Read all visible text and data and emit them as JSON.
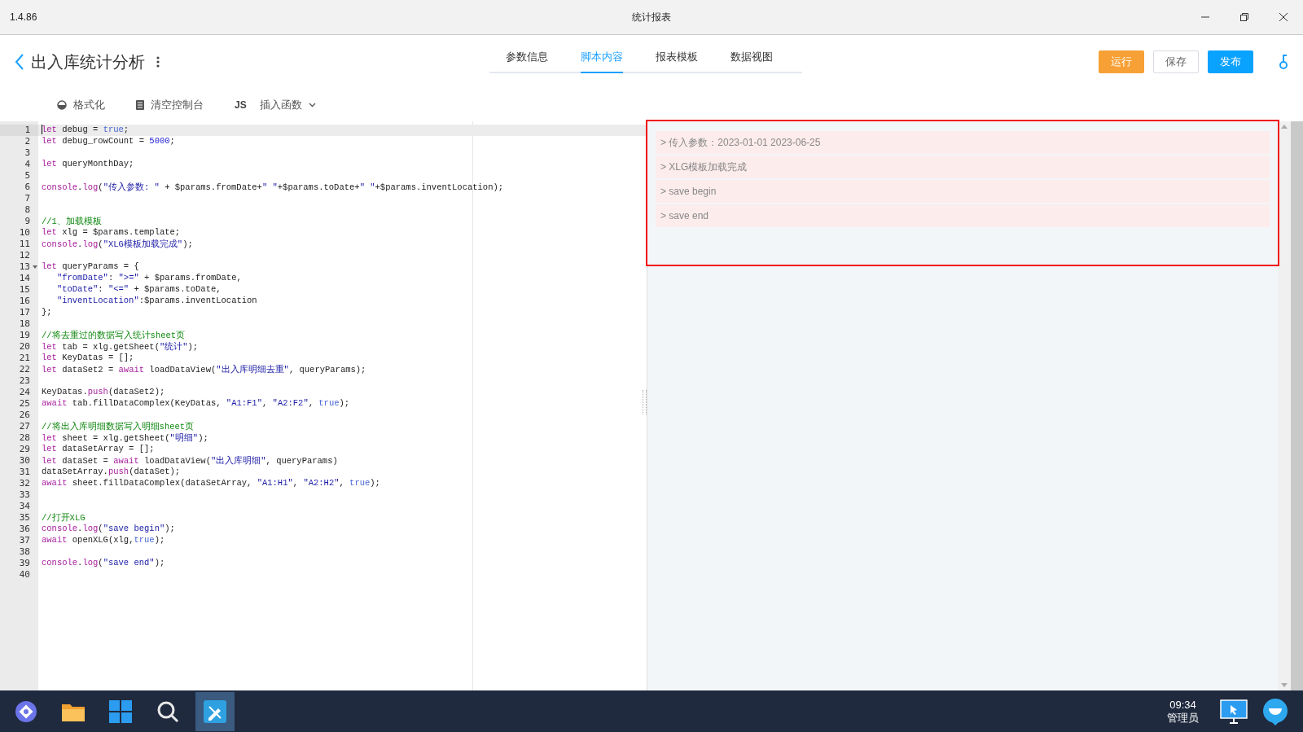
{
  "window": {
    "version": "1.4.86",
    "title": "统计报表"
  },
  "header": {
    "title": "出入库统计分析",
    "tabs": [
      {
        "label": "参数信息",
        "selected": false
      },
      {
        "label": "脚本内容",
        "selected": true
      },
      {
        "label": "报表模板",
        "selected": false
      },
      {
        "label": "数据视图",
        "selected": false
      }
    ],
    "buttons": [
      {
        "label": "运行",
        "kind": "warning"
      },
      {
        "label": "保存",
        "kind": "outline"
      },
      {
        "label": "发布",
        "kind": "primary"
      }
    ]
  },
  "toolbar": [
    {
      "label": "格式化",
      "kind": "format"
    },
    {
      "label": "清空控制台",
      "kind": "clear"
    },
    {
      "label": "插入函数",
      "kind": "insert",
      "prefix": "JS",
      "dropdown": true
    }
  ],
  "editor": {
    "lines": [
      {
        "number": "1",
        "selected": true,
        "foldable": false,
        "tokens": [
          {
            "kind": "kw",
            "text": "let"
          },
          {
            "kind": "plain",
            "text": " debug = "
          },
          {
            "kind": "atom",
            "text": "true"
          },
          {
            "kind": "plain",
            "text": ";"
          }
        ]
      },
      {
        "number": "2",
        "selected": false,
        "foldable": false,
        "tokens": [
          {
            "kind": "kw",
            "text": "let"
          },
          {
            "kind": "plain",
            "text": " debug_rowCount = "
          },
          {
            "kind": "num",
            "text": "5000"
          },
          {
            "kind": "plain",
            "text": ";"
          }
        ]
      },
      {
        "number": "3",
        "selected": false,
        "foldable": false
      },
      {
        "number": "4",
        "selected": false,
        "foldable": false,
        "tokens": [
          {
            "kind": "kw",
            "text": "let"
          },
          {
            "kind": "plain",
            "text": " queryMonthDay;"
          }
        ]
      },
      {
        "number": "5",
        "selected": false,
        "foldable": false
      },
      {
        "number": "6",
        "selected": false,
        "foldable": false,
        "tokens": [
          {
            "kind": "kw",
            "text": "console"
          },
          {
            "kind": "plain",
            "text": "."
          },
          {
            "kind": "kw",
            "text": "log"
          },
          {
            "kind": "plain",
            "text": "("
          },
          {
            "kind": "str",
            "text": "\"传入参数: \""
          },
          {
            "kind": "plain",
            "text": " + $params.fromDate+"
          },
          {
            "kind": "str",
            "text": "\" \""
          },
          {
            "kind": "plain",
            "text": "+$params.toDate+"
          },
          {
            "kind": "str",
            "text": "\" \""
          },
          {
            "kind": "plain",
            "text": "+$params.inventLocation);"
          }
        ]
      },
      {
        "number": "7",
        "selected": false,
        "foldable": false
      },
      {
        "number": "8",
        "selected": false,
        "foldable": false
      },
      {
        "number": "9",
        "selected": false,
        "foldable": false,
        "tokens": [
          {
            "kind": "comment",
            "text": "//1、加载模板"
          }
        ]
      },
      {
        "number": "10",
        "selected": false,
        "foldable": false,
        "tokens": [
          {
            "kind": "kw",
            "text": "let"
          },
          {
            "kind": "plain",
            "text": " xlg = $params.template;"
          }
        ]
      },
      {
        "number": "11",
        "selected": false,
        "foldable": false,
        "tokens": [
          {
            "kind": "kw",
            "text": "console"
          },
          {
            "kind": "plain",
            "text": "."
          },
          {
            "kind": "kw",
            "text": "log"
          },
          {
            "kind": "plain",
            "text": "("
          },
          {
            "kind": "str",
            "text": "\"XLG模板加载完成\""
          },
          {
            "kind": "plain",
            "text": ");"
          }
        ]
      },
      {
        "number": "12",
        "selected": false,
        "foldable": false
      },
      {
        "number": "13",
        "selected": false,
        "foldable": true,
        "tokens": [
          {
            "kind": "kw",
            "text": "let"
          },
          {
            "kind": "plain",
            "text": " queryParams = {"
          }
        ]
      },
      {
        "number": "14",
        "selected": false,
        "foldable": false,
        "tokens": [
          {
            "kind": "str",
            "text": "   \"fromDate\""
          },
          {
            "kind": "plain",
            "text": ": "
          },
          {
            "kind": "str",
            "text": "\">=\""
          },
          {
            "kind": "plain",
            "text": " + $params.fromDate,"
          }
        ]
      },
      {
        "number": "15",
        "selected": false,
        "foldable": false,
        "tokens": [
          {
            "kind": "str",
            "text": "   \"toDate\""
          },
          {
            "kind": "plain",
            "text": ": "
          },
          {
            "kind": "str",
            "text": "\"<=\""
          },
          {
            "kind": "plain",
            "text": " + $params.toDate,"
          }
        ]
      },
      {
        "number": "16",
        "selected": false,
        "foldable": false,
        "tokens": [
          {
            "kind": "str",
            "text": "   \"inventLocation\""
          },
          {
            "kind": "plain",
            "text": ":$params.inventLocation"
          }
        ]
      },
      {
        "number": "17",
        "selected": false,
        "foldable": false,
        "tokens": [
          {
            "kind": "plain",
            "text": "};"
          }
        ]
      },
      {
        "number": "18",
        "selected": false,
        "foldable": false
      },
      {
        "number": "19",
        "selected": false,
        "foldable": false,
        "tokens": [
          {
            "kind": "comment",
            "text": "//将去重过的数据写入统计sheet页"
          }
        ]
      },
      {
        "number": "20",
        "selected": false,
        "foldable": false,
        "tokens": [
          {
            "kind": "kw",
            "text": "let"
          },
          {
            "kind": "plain",
            "text": " tab = xlg.getSheet("
          },
          {
            "kind": "str",
            "text": "\"统计\""
          },
          {
            "kind": "plain",
            "text": ");"
          }
        ]
      },
      {
        "number": "21",
        "selected": false,
        "foldable": false,
        "tokens": [
          {
            "kind": "kw",
            "text": "let"
          },
          {
            "kind": "plain",
            "text": " KeyDatas = [];"
          }
        ]
      },
      {
        "number": "22",
        "selected": false,
        "foldable": false,
        "tokens": [
          {
            "kind": "kw",
            "text": "let"
          },
          {
            "kind": "plain",
            "text": " dataSet2 = "
          },
          {
            "kind": "kw",
            "text": "await"
          },
          {
            "kind": "plain",
            "text": " loadDataView("
          },
          {
            "kind": "str",
            "text": "\"出入库明细去重\""
          },
          {
            "kind": "plain",
            "text": ", queryParams);"
          }
        ]
      },
      {
        "number": "23",
        "selected": false,
        "foldable": false
      },
      {
        "number": "24",
        "selected": false,
        "foldable": false,
        "tokens": [
          {
            "kind": "plain",
            "text": "KeyDatas."
          },
          {
            "kind": "kw",
            "text": "push"
          },
          {
            "kind": "plain",
            "text": "(dataSet2);"
          }
        ]
      },
      {
        "number": "25",
        "selected": false,
        "foldable": false,
        "tokens": [
          {
            "kind": "kw",
            "text": "await"
          },
          {
            "kind": "plain",
            "text": " tab.fillDataComplex(KeyDatas, "
          },
          {
            "kind": "str",
            "text": "\"A1:F1\""
          },
          {
            "kind": "plain",
            "text": ", "
          },
          {
            "kind": "str",
            "text": "\"A2:F2\""
          },
          {
            "kind": "plain",
            "text": ", "
          },
          {
            "kind": "atom",
            "text": "true"
          },
          {
            "kind": "plain",
            "text": ");"
          }
        ]
      },
      {
        "number": "26",
        "selected": false,
        "foldable": false
      },
      {
        "number": "27",
        "selected": false,
        "foldable": false,
        "tokens": [
          {
            "kind": "comment",
            "text": "//将出入库明细数据写入明细sheet页"
          }
        ]
      },
      {
        "number": "28",
        "selected": false,
        "foldable": false,
        "tokens": [
          {
            "kind": "kw",
            "text": "let"
          },
          {
            "kind": "plain",
            "text": " sheet = xlg.getSheet("
          },
          {
            "kind": "str",
            "text": "\"明细\""
          },
          {
            "kind": "plain",
            "text": ");"
          }
        ]
      },
      {
        "number": "29",
        "selected": false,
        "foldable": false,
        "tokens": [
          {
            "kind": "kw",
            "text": "let"
          },
          {
            "kind": "plain",
            "text": " dataSetArray = [];"
          }
        ]
      },
      {
        "number": "30",
        "selected": false,
        "foldable": false,
        "tokens": [
          {
            "kind": "kw",
            "text": "let"
          },
          {
            "kind": "plain",
            "text": " dataSet = "
          },
          {
            "kind": "kw",
            "text": "await"
          },
          {
            "kind": "plain",
            "text": " loadDataView("
          },
          {
            "kind": "str",
            "text": "\"出入库明细\""
          },
          {
            "kind": "plain",
            "text": ", queryParams)"
          }
        ]
      },
      {
        "number": "31",
        "selected": false,
        "foldable": false,
        "tokens": [
          {
            "kind": "plain",
            "text": "dataSetArray."
          },
          {
            "kind": "kw",
            "text": "push"
          },
          {
            "kind": "plain",
            "text": "(dataSet);"
          }
        ]
      },
      {
        "number": "32",
        "selected": false,
        "foldable": false,
        "tokens": [
          {
            "kind": "kw",
            "text": "await"
          },
          {
            "kind": "plain",
            "text": " sheet.fillDataComplex(dataSetArray, "
          },
          {
            "kind": "str",
            "text": "\"A1:H1\""
          },
          {
            "kind": "plain",
            "text": ", "
          },
          {
            "kind": "str",
            "text": "\"A2:H2\""
          },
          {
            "kind": "plain",
            "text": ", "
          },
          {
            "kind": "atom",
            "text": "true"
          },
          {
            "kind": "plain",
            "text": ");"
          }
        ]
      },
      {
        "number": "33",
        "selected": false,
        "foldable": false
      },
      {
        "number": "34",
        "selected": false,
        "foldable": false
      },
      {
        "number": "35",
        "selected": false,
        "foldable": false,
        "tokens": [
          {
            "kind": "comment",
            "text": "//打开XLG"
          }
        ]
      },
      {
        "number": "36",
        "selected": false,
        "foldable": false,
        "tokens": [
          {
            "kind": "kw",
            "text": "console"
          },
          {
            "kind": "plain",
            "text": "."
          },
          {
            "kind": "kw",
            "text": "log"
          },
          {
            "kind": "plain",
            "text": "("
          },
          {
            "kind": "str",
            "text": "\"save begin\""
          },
          {
            "kind": "plain",
            "text": ");"
          }
        ]
      },
      {
        "number": "37",
        "selected": false,
        "foldable": false,
        "tokens": [
          {
            "kind": "kw",
            "text": "await"
          },
          {
            "kind": "plain",
            "text": " openXLG(xlg,"
          },
          {
            "kind": "atom",
            "text": "true"
          },
          {
            "kind": "plain",
            "text": ");"
          }
        ]
      },
      {
        "number": "38",
        "selected": false,
        "foldable": false
      },
      {
        "number": "39",
        "selected": false,
        "foldable": false,
        "tokens": [
          {
            "kind": "kw",
            "text": "console"
          },
          {
            "kind": "plain",
            "text": "."
          },
          {
            "kind": "kw",
            "text": "log"
          },
          {
            "kind": "plain",
            "text": "("
          },
          {
            "kind": "str",
            "text": "\"save end\""
          },
          {
            "kind": "plain",
            "text": ");"
          }
        ]
      },
      {
        "number": "40",
        "selected": false,
        "foldable": false
      }
    ]
  },
  "console": {
    "highlighted": true,
    "messages": [
      "> 传入参数：2023-01-01 2023-06-25",
      "> XLG模板加载完成",
      "> save begin",
      "> save end"
    ]
  },
  "taskbar": {
    "apps": [
      {
        "kind": "launcher",
        "selected": false
      },
      {
        "kind": "folder",
        "selected": false
      },
      {
        "kind": "windows",
        "selected": false
      },
      {
        "kind": "search",
        "selected": false
      },
      {
        "kind": "designer",
        "selected": true
      }
    ],
    "time": "09:34",
    "user": "管理员"
  }
}
